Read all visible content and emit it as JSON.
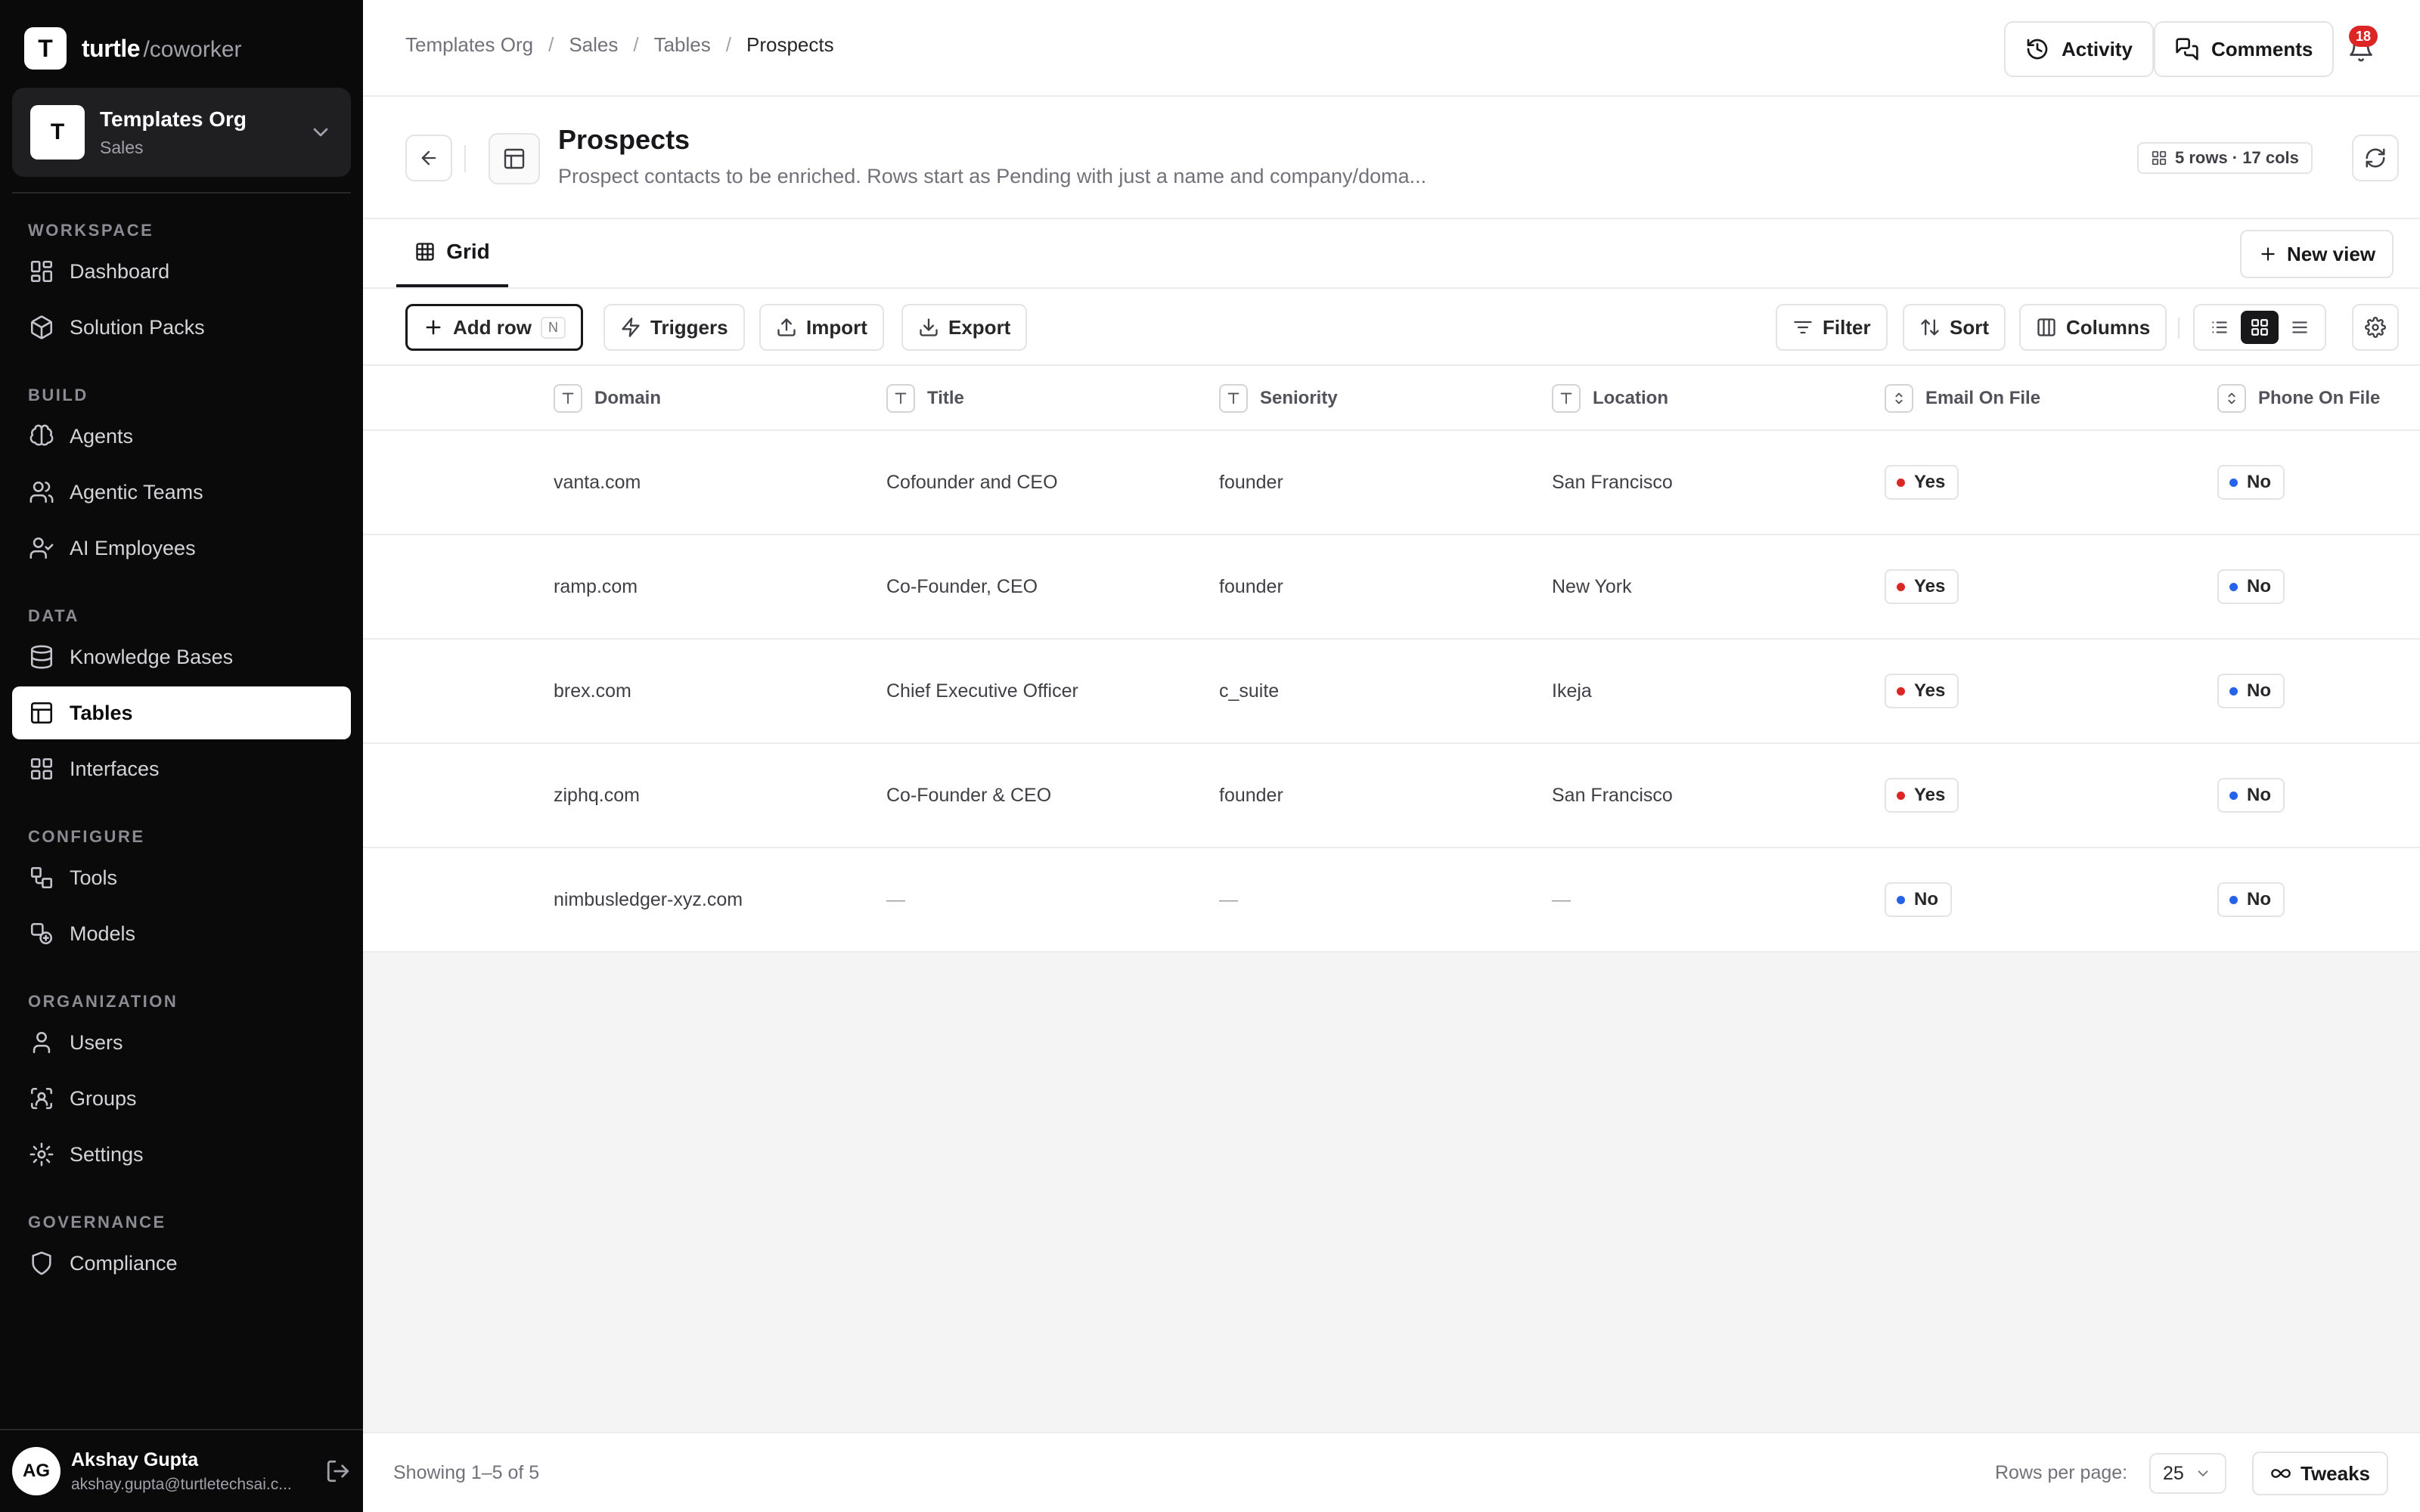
{
  "brand": {
    "logo_letter": "T",
    "name": "turtle",
    "suffix": "/coworker"
  },
  "org": {
    "avatar": "T",
    "name": "Templates Org",
    "sub": "Sales"
  },
  "sidebar": {
    "sections": [
      {
        "label": "WORKSPACE",
        "items": [
          {
            "label": "Dashboard",
            "icon": "dashboard-icon"
          },
          {
            "label": "Solution Packs",
            "icon": "package-icon"
          }
        ]
      },
      {
        "label": "BUILD",
        "items": [
          {
            "label": "Agents",
            "icon": "brain-icon"
          },
          {
            "label": "Agentic Teams",
            "icon": "users-icon"
          },
          {
            "label": "AI Employees",
            "icon": "user-check-icon"
          }
        ]
      },
      {
        "label": "DATA",
        "items": [
          {
            "label": "Knowledge Bases",
            "icon": "database-icon"
          },
          {
            "label": "Tables",
            "icon": "table-icon",
            "active": true
          },
          {
            "label": "Interfaces",
            "icon": "layout-icon"
          }
        ]
      },
      {
        "label": "CONFIGURE",
        "items": [
          {
            "label": "Tools",
            "icon": "tools-icon"
          },
          {
            "label": "Models",
            "icon": "models-icon"
          }
        ]
      },
      {
        "label": "ORGANIZATION",
        "items": [
          {
            "label": "Users",
            "icon": "user-icon"
          },
          {
            "label": "Groups",
            "icon": "groups-icon"
          },
          {
            "label": "Settings",
            "icon": "gear-icon"
          }
        ]
      },
      {
        "label": "GOVERNANCE",
        "items": [
          {
            "label": "Compliance",
            "icon": "shield-icon"
          }
        ]
      }
    ]
  },
  "user": {
    "initials": "AG",
    "name": "Akshay Gupta",
    "email": "akshay.gupta@turtletechsai.c..."
  },
  "breadcrumb": [
    "Templates Org",
    "Sales",
    "Tables",
    "Prospects"
  ],
  "topbar": {
    "activity_label": "Activity",
    "comments_label": "Comments",
    "notification_count": "18"
  },
  "header": {
    "title": "Prospects",
    "description": "Prospect contacts to be enriched. Rows start as Pending with just a name and company/doma...",
    "meta": "5 rows · 17 cols"
  },
  "tabs": {
    "grid_label": "Grid",
    "new_view_label": "New view"
  },
  "toolbar": {
    "add_row_label": "Add row",
    "add_row_shortcut": "N",
    "triggers_label": "Triggers",
    "import_label": "Import",
    "export_label": "Export",
    "filter_label": "Filter",
    "sort_label": "Sort",
    "columns_label": "Columns"
  },
  "table": {
    "columns": [
      {
        "label": "Domain",
        "type": "text"
      },
      {
        "label": "Title",
        "type": "text"
      },
      {
        "label": "Seniority",
        "type": "text"
      },
      {
        "label": "Location",
        "type": "text"
      },
      {
        "label": "Email On File",
        "type": "select"
      },
      {
        "label": "Phone On File",
        "type": "select"
      }
    ],
    "rows": [
      [
        "vanta.com",
        "Cofounder and CEO",
        "founder",
        "San Francisco",
        "Yes",
        "No"
      ],
      [
        "ramp.com",
        "Co-Founder, CEO",
        "founder",
        "New York",
        "Yes",
        "No"
      ],
      [
        "brex.com",
        "Chief Executive Officer",
        "c_suite",
        "Ikeja",
        "Yes",
        "No"
      ],
      [
        "ziphq.com",
        "Co-Founder & CEO",
        "founder",
        "San Francisco",
        "Yes",
        "No"
      ],
      [
        "nimbusledger-xyz.com",
        "—",
        "—",
        "—",
        "No",
        "No"
      ]
    ],
    "pill_colors": {
      "Yes": "#dc2626",
      "No": "#2563eb"
    }
  },
  "footer": {
    "showing": "Showing 1–5 of 5",
    "rows_per_page_label": "Rows per page:",
    "rows_per_page_value": "25",
    "tweaks_label": "Tweaks"
  }
}
